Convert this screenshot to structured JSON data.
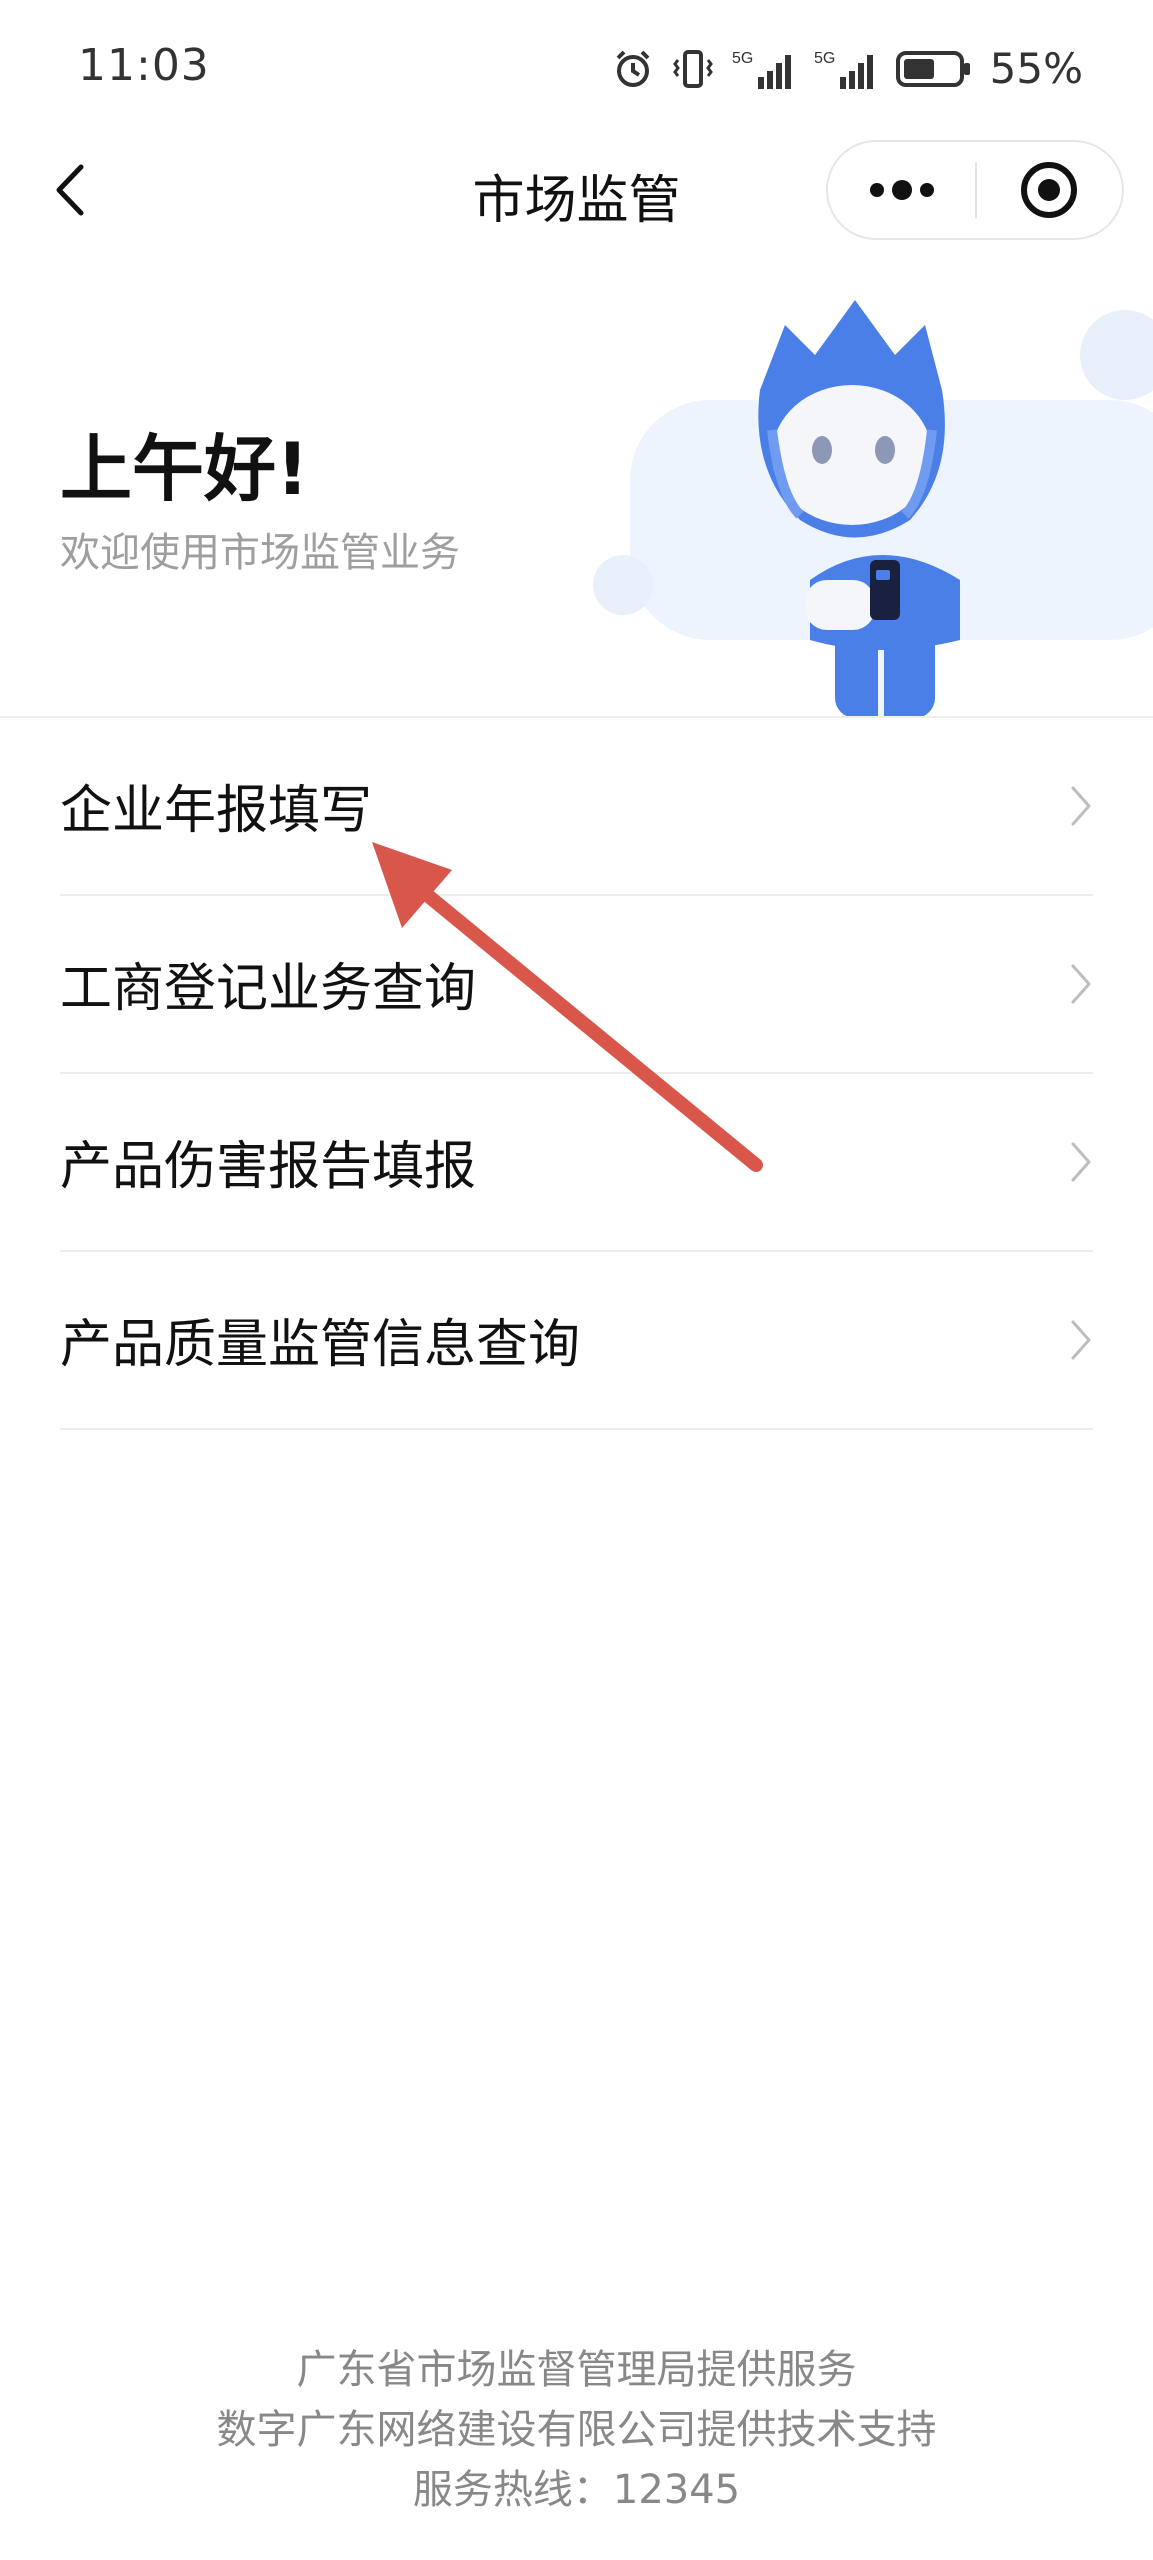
{
  "status_bar": {
    "time": "11:03",
    "battery": "55%",
    "signal1": "5G",
    "signal2": "5G"
  },
  "nav": {
    "title": "市场监管"
  },
  "hero": {
    "greeting": "上午好!",
    "subtitle": "欢迎使用市场监管业务"
  },
  "menu": {
    "items": [
      {
        "label": "企业年报填写"
      },
      {
        "label": "工商登记业务查询"
      },
      {
        "label": "产品伤害报告填报"
      },
      {
        "label": "产品质量监管信息查询"
      }
    ]
  },
  "footer": {
    "line1": "广东省市场监督管理局提供服务",
    "line2": "数字广东网络建设有限公司提供技术支持",
    "line3": "服务热线：12345"
  },
  "colors": {
    "accent_blue": "#4a7fe8",
    "arrow_red": "#d9574a",
    "hero_bg": "#eef4fd"
  },
  "icons": [
    "alarm-icon",
    "vibrate-icon",
    "signal-icon",
    "battery-icon",
    "back-icon",
    "more-icon",
    "close-target-icon",
    "chevron-right-icon"
  ]
}
